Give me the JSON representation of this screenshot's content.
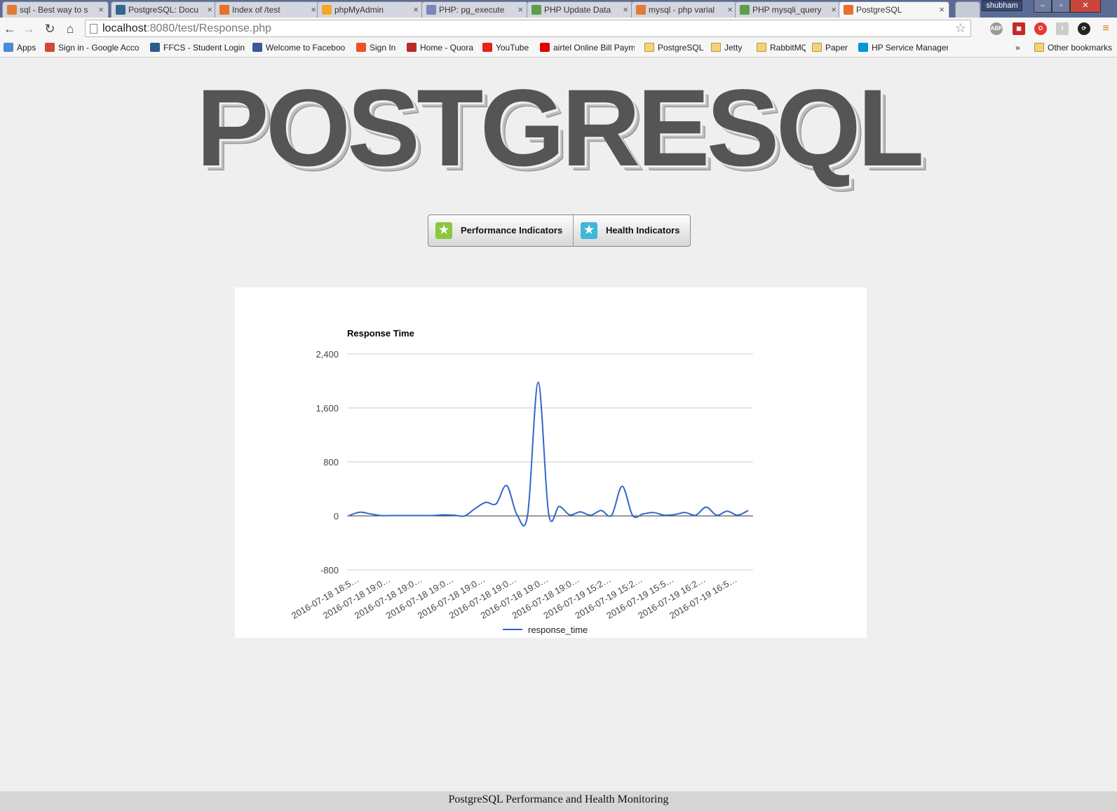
{
  "browser": {
    "tabs": [
      {
        "title": "sql - Best way to s",
        "icon_color": "#e07b39"
      },
      {
        "title": "PostgreSQL: Docu",
        "icon_color": "#336791"
      },
      {
        "title": "Index of /test",
        "icon_color": "#e8702a"
      },
      {
        "title": "phpMyAdmin",
        "icon_color": "#f5a623"
      },
      {
        "title": "PHP: pg_execute",
        "icon_color": "#7a86b8"
      },
      {
        "title": "PHP Update Data",
        "icon_color": "#5aa04a"
      },
      {
        "title": "mysql - php varial",
        "icon_color": "#e07b39"
      },
      {
        "title": "PHP mysqli_query",
        "icon_color": "#5aa04a"
      },
      {
        "title": "PostgreSQL",
        "icon_color": "#e8702a"
      }
    ],
    "user": "shubham",
    "url_host": "localhost",
    "url_path": ":8080/test/Response.php",
    "bookmarks": [
      {
        "label": "Apps"
      },
      {
        "label": "Sign in - Google Acco"
      },
      {
        "label": "FFCS - Student Login"
      },
      {
        "label": "Welcome to Faceboo"
      },
      {
        "label": "Sign In"
      },
      {
        "label": "Home - Quora"
      },
      {
        "label": "YouTube"
      },
      {
        "label": "airtel Online Bill Paym"
      },
      {
        "label": "PostgreSQL"
      },
      {
        "label": "Jetty"
      },
      {
        "label": "RabbitMQ"
      },
      {
        "label": "Paper"
      },
      {
        "label": "HP Service Manager ("
      },
      {
        "label": "Other bookmarks"
      }
    ],
    "bookmarks_overflow": "»"
  },
  "page": {
    "title": "POSTGRESQL",
    "buttons": {
      "performance": "Performance Indicators",
      "health": "Health Indicators"
    },
    "footer": "PostgreSQL Performance and Health Monitoring"
  },
  "chart_data": {
    "type": "line",
    "title": "Response Time",
    "xlabel": "",
    "ylabel": "",
    "ylim": [
      -800,
      2400
    ],
    "yticks": [
      "2,400",
      "1,600",
      "800",
      "0",
      "-800"
    ],
    "ytick_values": [
      2400,
      1600,
      800,
      0,
      -800
    ],
    "grid": true,
    "legend_position": "bottom",
    "xtick_labels": [
      "2016-07-18 18:5…",
      "2016-07-18 19:0…",
      "2016-07-18 19:0…",
      "2016-07-18 19:0…",
      "2016-07-18 19:0…",
      "2016-07-18 19:0…",
      "2016-07-18 19:0…",
      "2016-07-18 19:0…",
      "2016-07-19 15:2…",
      "2016-07-19 15:2…",
      "2016-07-19 15:5…",
      "2016-07-19 16:2…",
      "2016-07-19 16:5…"
    ],
    "series": [
      {
        "name": "response_time",
        "color": "#3366cc",
        "values": [
          5,
          55,
          30,
          5,
          5,
          5,
          5,
          5,
          5,
          15,
          10,
          0,
          110,
          200,
          180,
          450,
          10,
          20,
          1980,
          30,
          140,
          15,
          60,
          10,
          80,
          10,
          440,
          5,
          30,
          50,
          10,
          20,
          50,
          10,
          130,
          10,
          70,
          10,
          80
        ]
      }
    ],
    "colors": {
      "line": "#3366cc",
      "grid": "#cccccc",
      "baseline": "#333333"
    }
  }
}
